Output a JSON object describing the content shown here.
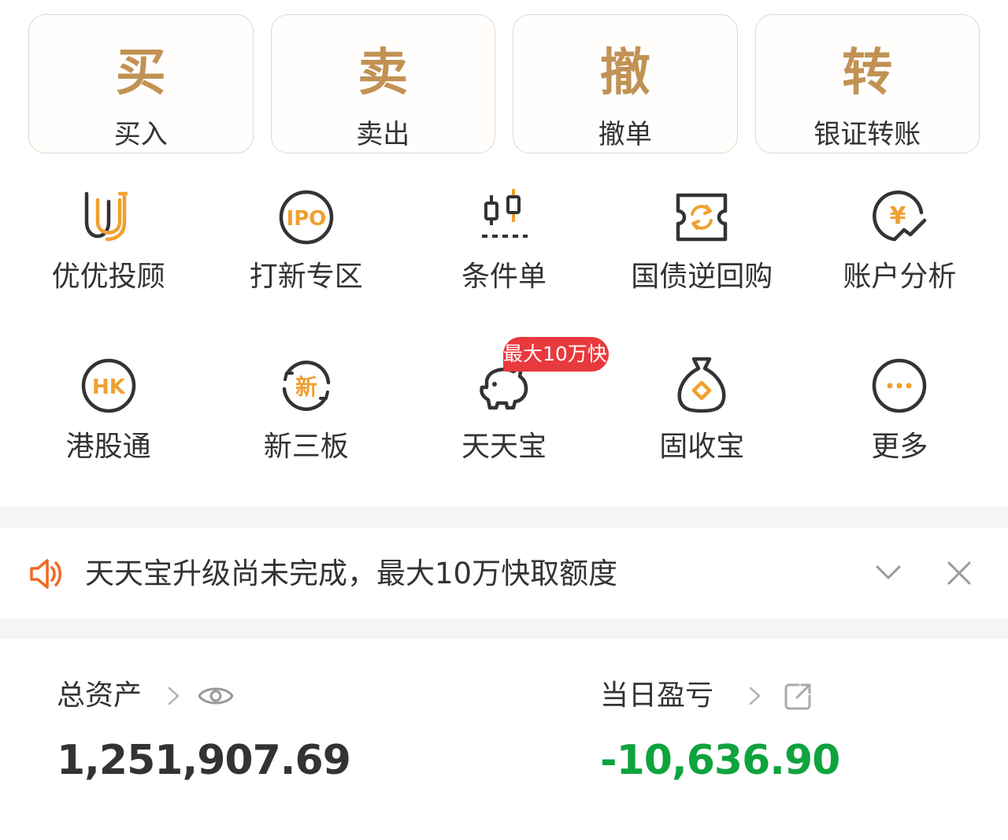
{
  "trade_actions": [
    {
      "glyph": "买",
      "label": "买入"
    },
    {
      "glyph": "卖",
      "label": "卖出"
    },
    {
      "glyph": "撤",
      "label": "撤单"
    },
    {
      "glyph": "转",
      "label": "银证转账"
    }
  ],
  "features_row1": [
    {
      "label": "优优投顾",
      "icon": "uu-advisor-icon"
    },
    {
      "label": "打新专区",
      "icon": "ipo-icon"
    },
    {
      "label": "条件单",
      "icon": "candlestick-icon"
    },
    {
      "label": "国债逆回购",
      "icon": "repo-ticket-icon"
    },
    {
      "label": "账户分析",
      "icon": "yen-chart-icon"
    }
  ],
  "features_row2": [
    {
      "label": "港股通",
      "icon": "hk-icon"
    },
    {
      "label": "新三板",
      "icon": "new-third-board-icon"
    },
    {
      "label": "天天宝",
      "icon": "piggy-bank-icon"
    },
    {
      "label": "固收宝",
      "icon": "money-bag-icon"
    },
    {
      "label": "更多",
      "icon": "more-icon"
    }
  ],
  "ipo_icon_text": "IPO",
  "hk_icon_text": "HK",
  "new_icon_text": "新",
  "yen_icon_text": "¥",
  "badge": {
    "text": "最大10万快"
  },
  "notice": {
    "text": "天天宝升级尚未完成，最大10万快取额度"
  },
  "assets": {
    "total_label": "总资产",
    "total_value": "1,251,907.69",
    "daily_label": "当日盈亏",
    "daily_value": "-10,636.90"
  },
  "colors": {
    "accent_gold": "#c19254",
    "icon_orange": "#f0a030",
    "icon_dark": "#333333",
    "badge_red": "#e8393d",
    "loss_green": "#0fa33e",
    "notice_orange": "#f06a1f"
  }
}
